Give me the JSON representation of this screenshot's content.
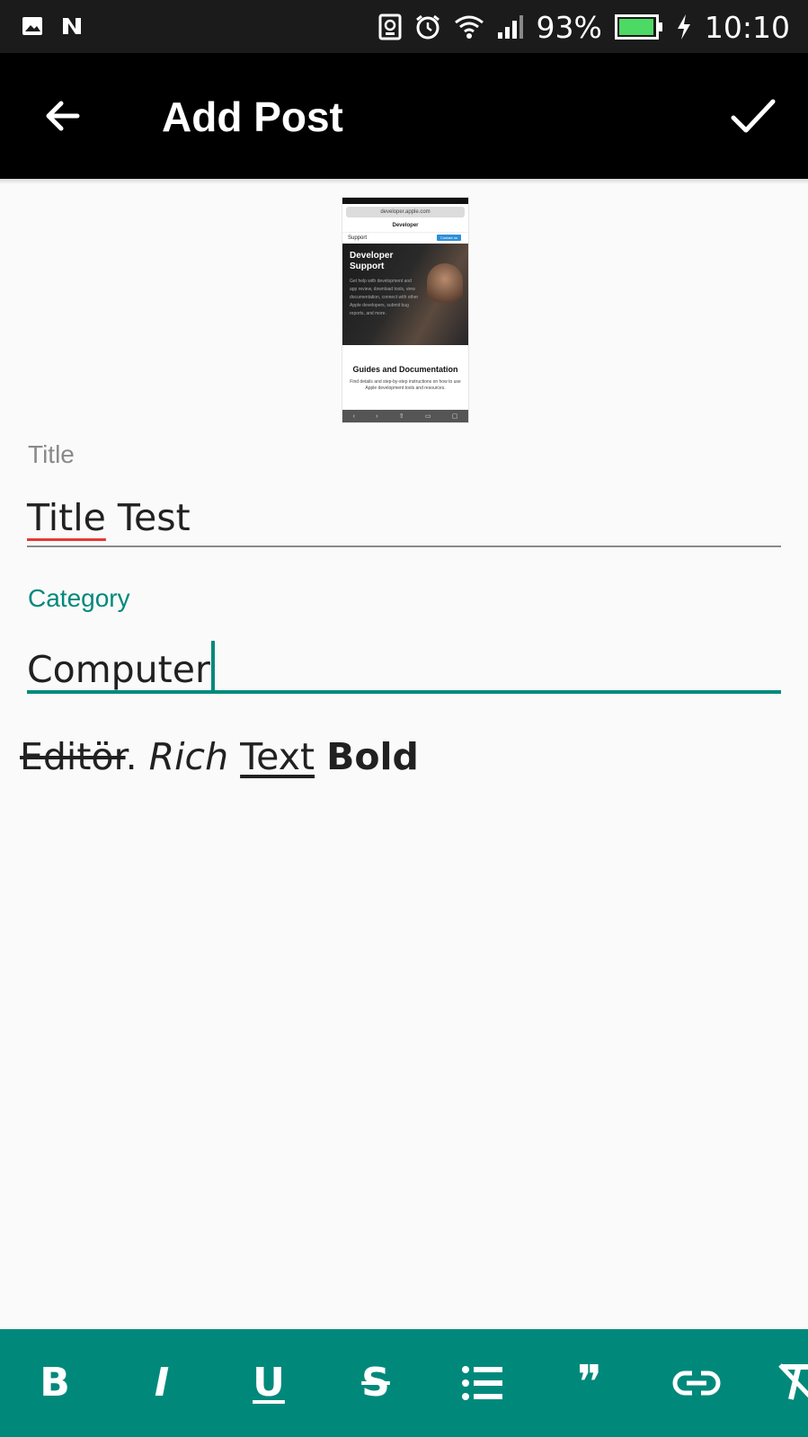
{
  "status_bar": {
    "icons": [
      "image-icon",
      "n-app-icon",
      "nfc-icon",
      "alarm-icon",
      "wifi-icon",
      "signal-icon",
      "battery-icon",
      "charging-icon"
    ],
    "battery": "93%",
    "time": "10:10"
  },
  "app_bar": {
    "title": "Add Post",
    "back_icon": "arrow-left-icon",
    "confirm_icon": "check-icon"
  },
  "thumbnail": {
    "url": "developer.apple.com",
    "nav_brand": "Developer",
    "section": "Support",
    "contact_button": "Contact us",
    "hero_title_line1": "Developer",
    "hero_title_line2": "Support",
    "hero_body": "Get help with development and app review, download tools, view documentation, connect with other Apple developers, submit bug reports, and more.",
    "guides_title": "Guides and Documentation",
    "guides_body": "Find details and step-by-step instructions on how to use Apple development tools and resources."
  },
  "form": {
    "title_label": "Title",
    "title_value_word1": "Title",
    "title_value_rest": " Test",
    "category_label": "Category",
    "category_value": "Computer"
  },
  "editor": {
    "strike_text": "Editör",
    "period": ". ",
    "italic_text": "Rich",
    "underline_text": "Text",
    "bold_text": "Bold"
  },
  "format_toolbar": {
    "buttons": [
      "bold",
      "italic",
      "underline",
      "strikethrough",
      "bullet-list",
      "quote",
      "link",
      "clear-format"
    ],
    "bold_glyph": "B",
    "italic_glyph": "I",
    "underline_glyph": "U",
    "strike_glyph": "S",
    "quote_glyph": "❞"
  },
  "colors": {
    "accent": "#00897b",
    "app_bar": "#000000",
    "status_bar": "#1b1b1b",
    "spell_error": "#e53935",
    "background": "#fafafa"
  }
}
